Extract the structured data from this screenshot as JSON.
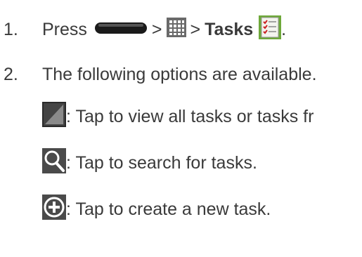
{
  "steps": [
    {
      "number": "1.",
      "press_label": "Press",
      "separator": ">",
      "tasks_label": "Tasks",
      "trailing": ".",
      "icons": [
        "home-key-icon",
        "apps-grid-icon",
        "tasks-app-icon"
      ]
    },
    {
      "number": "2.",
      "text": "The following options are available."
    }
  ],
  "options": [
    {
      "icon": "corner-triangle-icon",
      "text": ": Tap to view all tasks or tasks fr"
    },
    {
      "icon": "search-icon",
      "text": ": Tap to search for tasks."
    },
    {
      "icon": "add-circle-icon",
      "text": ": Tap to create a new task."
    }
  ]
}
